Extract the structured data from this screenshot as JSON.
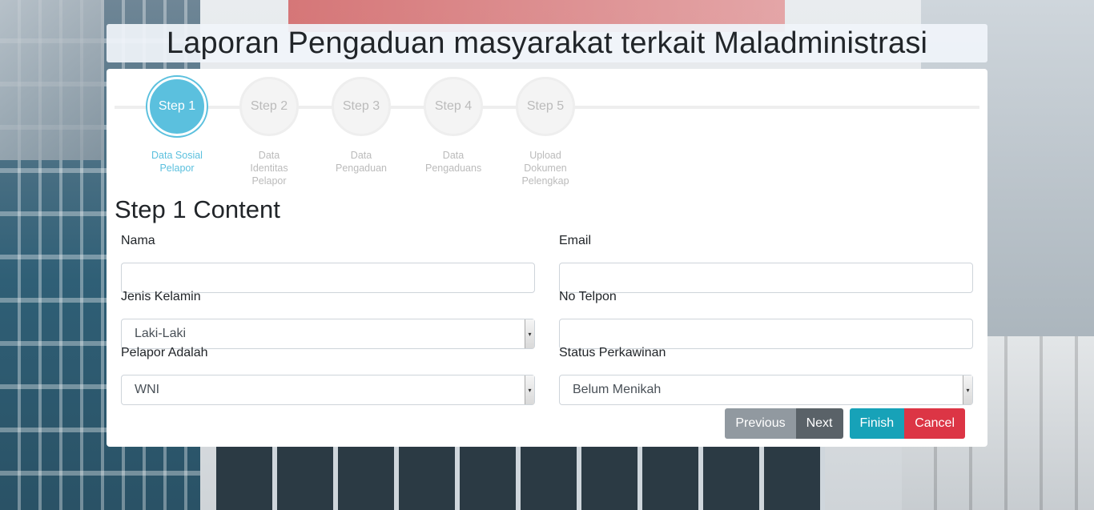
{
  "page": {
    "title": "Laporan Pengaduan masyarakat terkait Maladministrasi"
  },
  "wizard": {
    "steps": [
      {
        "number": "Step 1",
        "label": "Data Sosial Pelapor",
        "active": true
      },
      {
        "number": "Step 2",
        "label": "Data Identitas Pelapor",
        "active": false
      },
      {
        "number": "Step 3",
        "label": "Data Pengaduan",
        "active": false
      },
      {
        "number": "Step 4",
        "label": "Data Pengaduans",
        "active": false
      },
      {
        "number": "Step 5",
        "label": "Upload Dokumen Pelengkap",
        "active": false
      }
    ],
    "content_title": "Step 1 Content"
  },
  "form": {
    "nama": {
      "label": "Nama",
      "value": ""
    },
    "email": {
      "label": "Email",
      "value": ""
    },
    "jenis_kelamin": {
      "label": "Jenis Kelamin",
      "value": "Laki-Laki"
    },
    "no_telpon": {
      "label": "No Telpon",
      "value": ""
    },
    "pelapor_adalah": {
      "label": "Pelapor Adalah",
      "value": "WNI"
    },
    "status_perkawinan": {
      "label": "Status Perkawinan",
      "value": "Belum Menikah"
    }
  },
  "buttons": {
    "previous": "Previous",
    "next": "Next",
    "finish": "Finish",
    "cancel": "Cancel"
  },
  "colors": {
    "active_step": "#5bc0de",
    "finish": "#17a2b8",
    "cancel": "#dc3545",
    "secondary": "#868e96"
  }
}
